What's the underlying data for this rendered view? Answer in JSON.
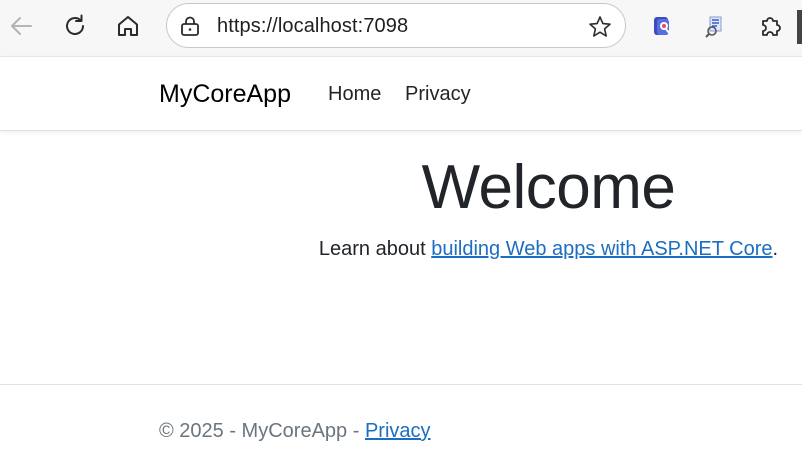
{
  "browser": {
    "url": "https://localhost:7098",
    "icons": [
      "back-arrow-icon",
      "reload-icon",
      "home-icon",
      "lock-icon",
      "star-icon",
      "extension-icon",
      "extension-icon",
      "puzzle-icon"
    ]
  },
  "navbar": {
    "brand": "MyCoreApp",
    "links": [
      {
        "label": "Home"
      },
      {
        "label": "Privacy"
      }
    ]
  },
  "main": {
    "heading": "Welcome",
    "learn_prefix": "Learn about ",
    "learn_link": "building Web apps with ASP.NET Core",
    "learn_suffix": "."
  },
  "footer": {
    "copyright": "© 2025 - MyCoreApp - ",
    "privacy_link": "Privacy"
  },
  "colors": {
    "link": "#1b6ec2",
    "text": "#212529",
    "muted": "#6c757d"
  }
}
